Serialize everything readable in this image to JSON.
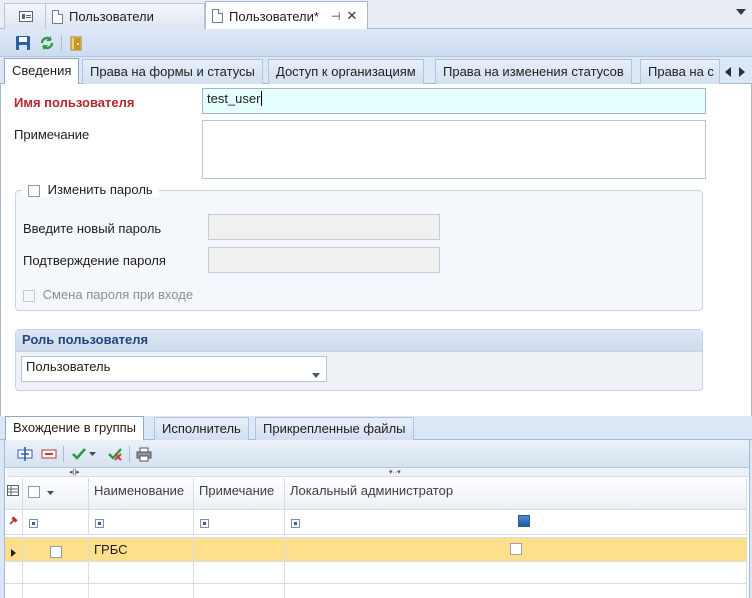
{
  "doc_tabs": [
    {
      "label": "Пользователи"
    },
    {
      "label": "Пользователи*"
    }
  ],
  "top_tabs": [
    {
      "label": "Сведения"
    },
    {
      "label": "Права на формы и статусы"
    },
    {
      "label": "Доступ к организациям"
    },
    {
      "label": "Права на изменения статусов"
    },
    {
      "label": "Права на с"
    }
  ],
  "form": {
    "username_label": "Имя пользователя",
    "username_value": "test_user",
    "note_label": "Примечание",
    "note_value": "",
    "change_password_label": "Изменить пароль",
    "new_password_label": "Введите новый пароль",
    "confirm_password_label": "Подтверждение пароля",
    "change_on_login_label": "Смена пароля при входе",
    "role_label": "Роль пользователя",
    "role_value": "Пользователь"
  },
  "bottom_tabs": [
    {
      "label": "Вхождение в группы"
    },
    {
      "label": "Исполнитель"
    },
    {
      "label": "Прикрепленные файлы"
    }
  ],
  "grid": {
    "columns": [
      "Наименование",
      "Примечание",
      "Локальный администратор"
    ],
    "rows": [
      {
        "name": "ГРБС",
        "note": "",
        "local_admin": false
      }
    ]
  },
  "colors": {
    "accent": "#24467c",
    "required": "#b3272d",
    "selected_row": "#fddf8c"
  }
}
